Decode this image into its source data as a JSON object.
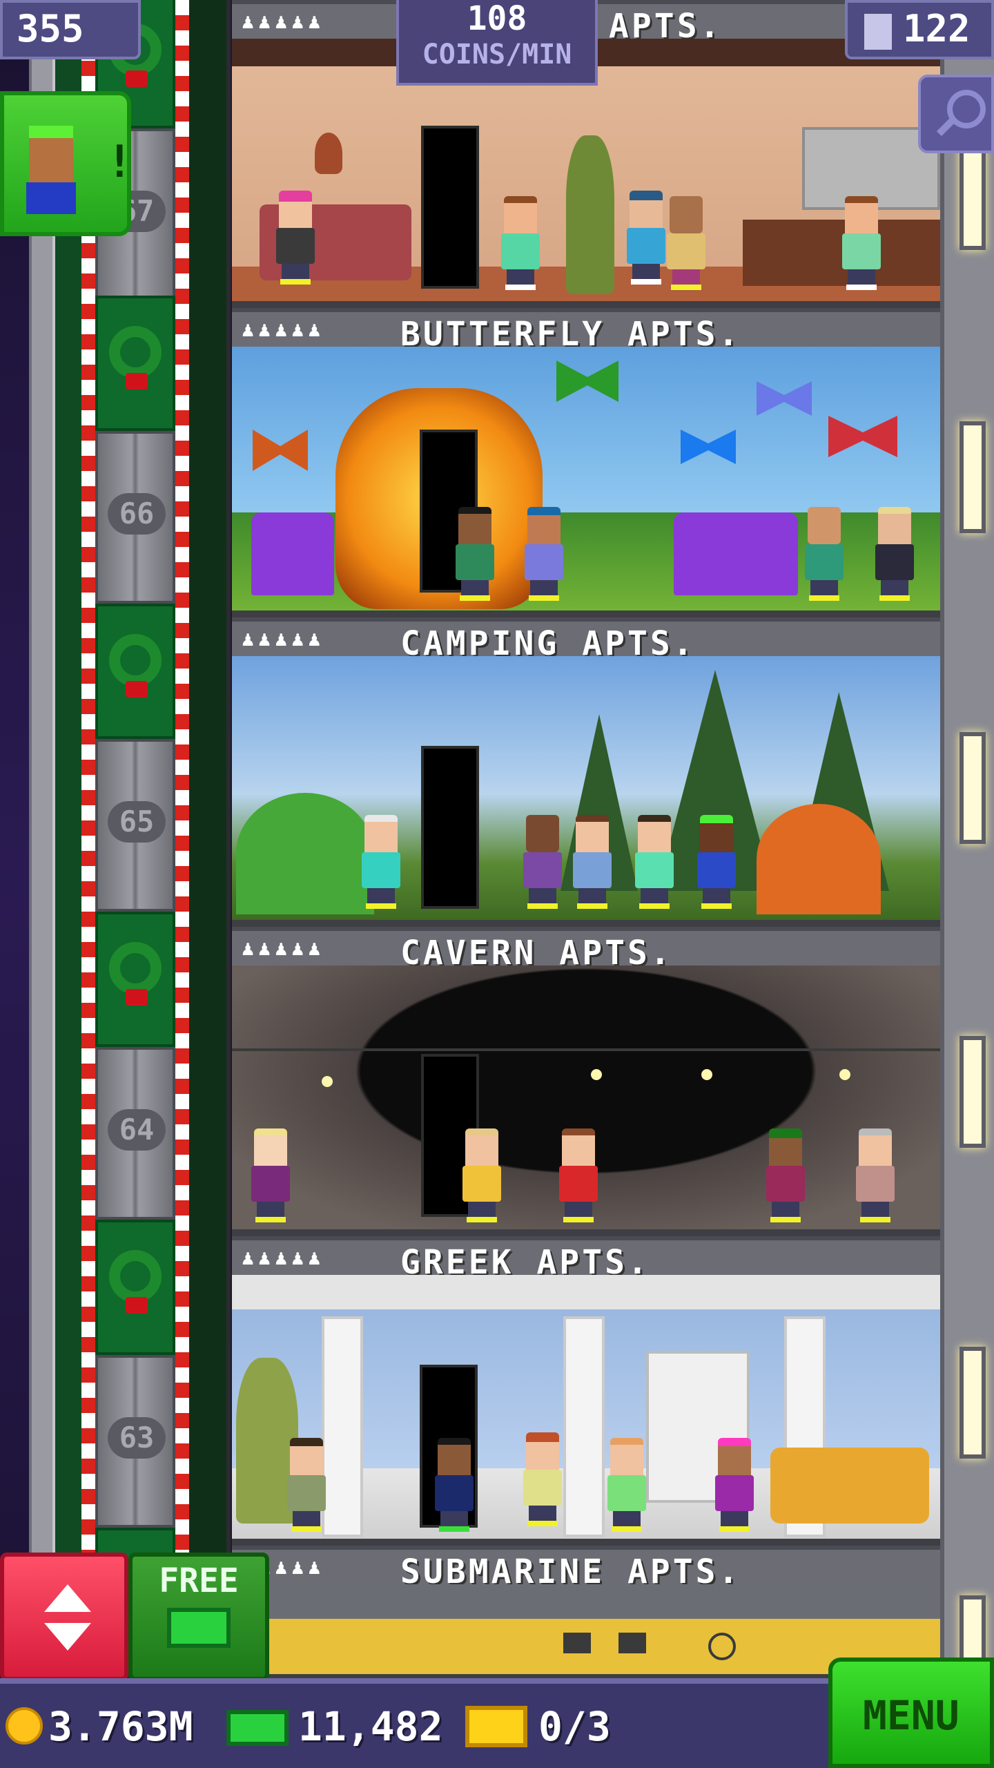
{
  "hud": {
    "population": "355",
    "coins_per_min_value": "108",
    "coins_per_min_label": "COINS/MIN",
    "floors_count": "122",
    "visitor_alert": "!"
  },
  "floors": [
    {
      "title": "APTS.",
      "people": "♟♟♟♟♟",
      "floor_number": "67"
    },
    {
      "title": "BUTTERFLY APTS.",
      "people": "♟♟♟♟♟",
      "floor_number": "66"
    },
    {
      "title": "CAMPING APTS.",
      "people": "♟♟♟♟♟",
      "floor_number": "65"
    },
    {
      "title": "CAVERN APTS.",
      "people": "♟♟♟♟♟",
      "floor_number": "64"
    },
    {
      "title": "GREEK APTS.",
      "people": "♟♟♟♟♟",
      "floor_number": "63"
    },
    {
      "title": "SUBMARINE APTS.",
      "people": "♟♟♟♟♟",
      "floor_number": ""
    }
  ],
  "controls": {
    "free_label": "FREE",
    "menu_label": "MENU"
  },
  "currency": {
    "coins": "3.763M",
    "bux": "11,482",
    "tickets": "0/3"
  },
  "colors": {
    "menu_green": "#2ad12a",
    "elevator_red": "#e8304c",
    "hud_purple": "#4e4a82"
  }
}
